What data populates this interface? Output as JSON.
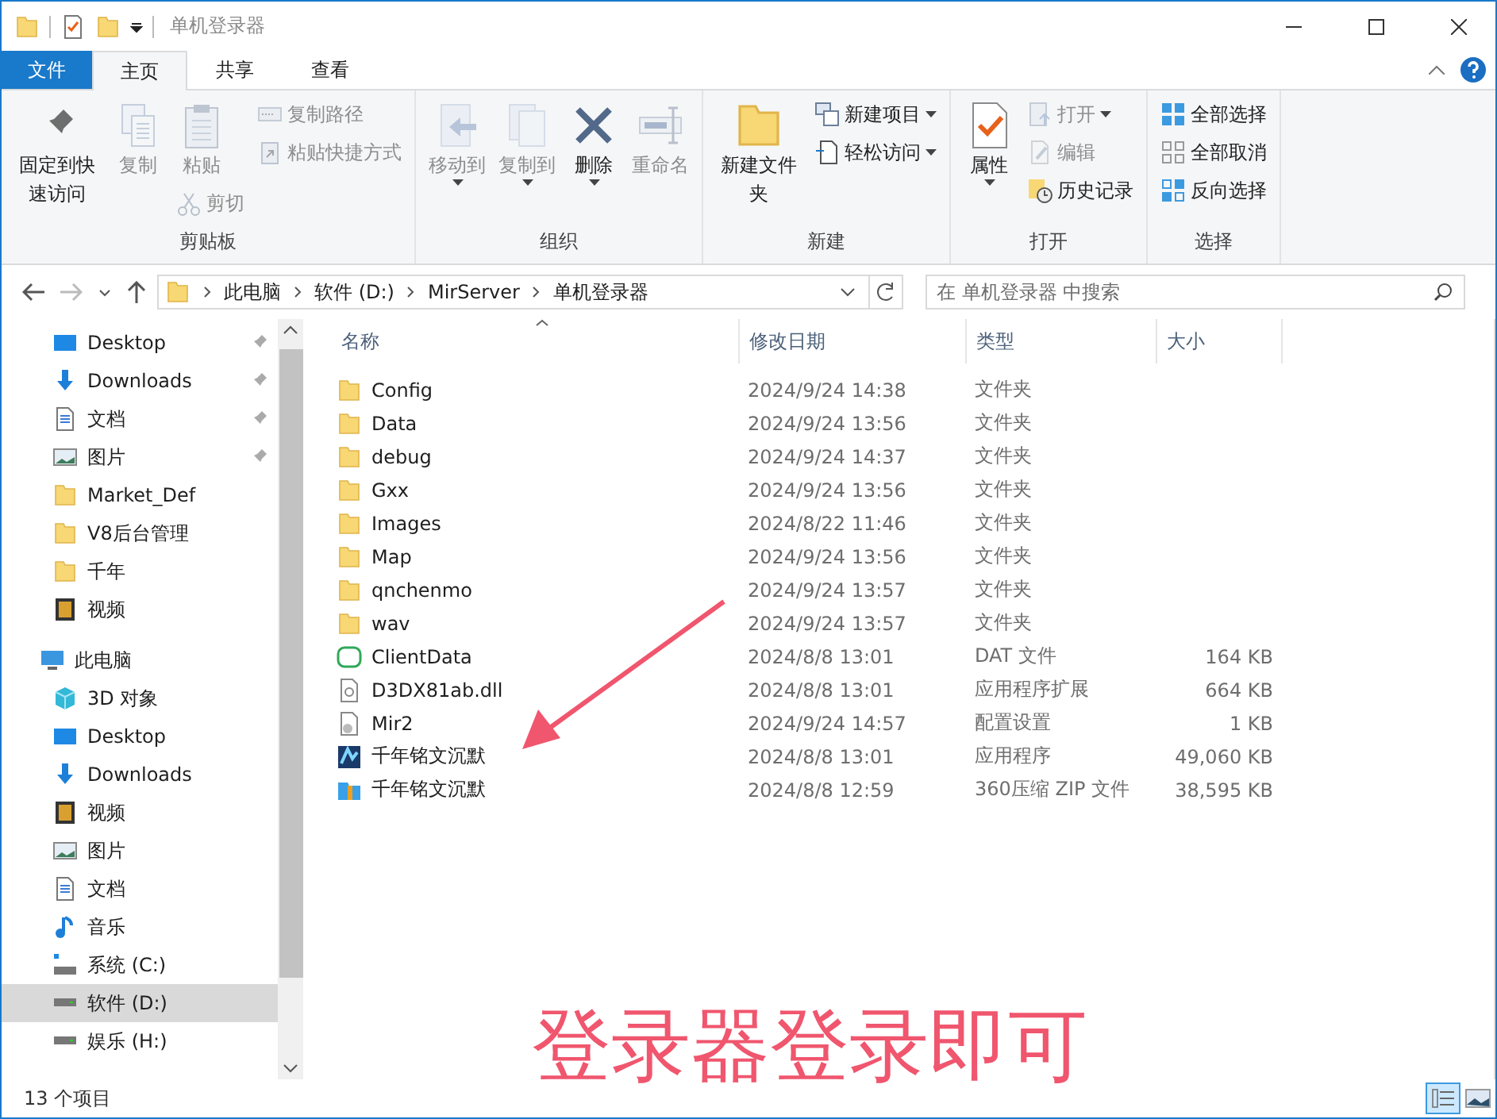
{
  "window": {
    "title": "单机登录器"
  },
  "ribbon": {
    "file_tab": "文件",
    "tabs": [
      {
        "label": "主页",
        "selected": true
      },
      {
        "label": "共享",
        "selected": false
      },
      {
        "label": "查看",
        "selected": false
      }
    ],
    "groups": [
      {
        "label": "剪贴板",
        "columns": [
          [
            {
              "label": "固定到快速访问",
              "kind": "large",
              "disabled": false,
              "dropdown": false
            }
          ],
          [
            {
              "label": "复制",
              "kind": "large",
              "disabled": true,
              "dropdown": false
            }
          ],
          [
            {
              "label": "粘贴",
              "kind": "large",
              "disabled": true,
              "dropdown": false
            },
            {
              "label": "剪切",
              "kind": "small",
              "disabled": true,
              "dropdown": false
            }
          ],
          [
            {
              "label": "复制路径",
              "kind": "small",
              "disabled": true,
              "dropdown": false
            },
            {
              "label": "粘贴快捷方式",
              "kind": "small",
              "disabled": true,
              "dropdown": false
            }
          ]
        ]
      },
      {
        "label": "组织",
        "columns": [
          [
            {
              "label": "移动到",
              "kind": "large",
              "disabled": true,
              "dropdown": true
            }
          ],
          [
            {
              "label": "复制到",
              "kind": "large",
              "disabled": true,
              "dropdown": true
            }
          ],
          [
            {
              "label": "删除",
              "kind": "large",
              "disabled": false,
              "dropdown": true
            }
          ],
          [
            {
              "label": "重命名",
              "kind": "large",
              "disabled": true,
              "dropdown": false
            }
          ]
        ]
      },
      {
        "label": "新建",
        "columns": [
          [
            {
              "label": "新建文件夹",
              "kind": "large",
              "disabled": false,
              "dropdown": false
            }
          ],
          [
            {
              "label": "新建项目",
              "kind": "small",
              "disabled": false,
              "dropdown": true
            },
            {
              "label": "轻松访问",
              "kind": "small",
              "disabled": false,
              "dropdown": true
            }
          ]
        ]
      },
      {
        "label": "打开",
        "columns": [
          [
            {
              "label": "属性",
              "kind": "large",
              "disabled": false,
              "dropdown": true
            }
          ],
          [
            {
              "label": "打开",
              "kind": "small",
              "disabled": true,
              "dropdown": true
            },
            {
              "label": "编辑",
              "kind": "small",
              "disabled": true,
              "dropdown": false
            },
            {
              "label": "历史记录",
              "kind": "small",
              "disabled": false,
              "dropdown": false
            }
          ]
        ]
      },
      {
        "label": "选择",
        "columns": [
          [
            {
              "label": "全部选择",
              "kind": "small",
              "disabled": false,
              "dropdown": false
            },
            {
              "label": "全部取消",
              "kind": "small",
              "disabled": false,
              "dropdown": false
            },
            {
              "label": "反向选择",
              "kind": "small",
              "disabled": false,
              "dropdown": false
            }
          ]
        ]
      }
    ]
  },
  "address": {
    "crumbs": [
      "此电脑",
      "软件 (D:)",
      "MirServer",
      "单机登录器"
    ]
  },
  "search": {
    "placeholder": "在 单机登录器 中搜索"
  },
  "nav": {
    "quick_access": [
      {
        "label": "Desktop",
        "kind": "desktop",
        "pinned": true,
        "selected": false
      },
      {
        "label": "Downloads",
        "kind": "downloads",
        "pinned": true,
        "selected": false
      },
      {
        "label": "文档",
        "kind": "documents",
        "pinned": true,
        "selected": false
      },
      {
        "label": "图片",
        "kind": "pictures",
        "pinned": true,
        "selected": false
      },
      {
        "label": "Market_Def",
        "kind": "folder",
        "pinned": false,
        "selected": false
      },
      {
        "label": "V8后台管理",
        "kind": "folder",
        "pinned": false,
        "selected": false
      },
      {
        "label": "千年",
        "kind": "folder",
        "pinned": false,
        "selected": false
      },
      {
        "label": "视频",
        "kind": "videos",
        "pinned": false,
        "selected": false
      }
    ],
    "tree": [
      {
        "label": "此电脑",
        "kind": "pc",
        "selected": false,
        "children": [
          {
            "label": "3D 对象",
            "kind": "objects3d",
            "selected": false
          },
          {
            "label": "Desktop",
            "kind": "desktop",
            "selected": false
          },
          {
            "label": "Downloads",
            "kind": "downloads",
            "selected": false
          },
          {
            "label": "视频",
            "kind": "videos",
            "selected": false
          },
          {
            "label": "图片",
            "kind": "pictures",
            "selected": false
          },
          {
            "label": "文档",
            "kind": "documents",
            "selected": false
          },
          {
            "label": "音乐",
            "kind": "music",
            "selected": false
          },
          {
            "label": "系统 (C:)",
            "kind": "system-drive",
            "selected": false
          },
          {
            "label": "软件 (D:)",
            "kind": "drive",
            "selected": true
          },
          {
            "label": "娱乐 (H:)",
            "kind": "drive",
            "selected": false
          }
        ]
      }
    ]
  },
  "files": {
    "columns": [
      {
        "label": "名称",
        "sorted": true
      },
      {
        "label": "修改日期",
        "sorted": false
      },
      {
        "label": "类型",
        "sorted": false
      },
      {
        "label": "大小",
        "sorted": false
      }
    ],
    "rows": [
      {
        "name": "Config",
        "modified": "2024/9/24 14:38",
        "type": "文件夹",
        "kind": "folder"
      },
      {
        "name": "Data",
        "modified": "2024/9/24 13:56",
        "type": "文件夹",
        "kind": "folder"
      },
      {
        "name": "debug",
        "modified": "2024/9/24 14:37",
        "type": "文件夹",
        "kind": "folder"
      },
      {
        "name": "Gxx",
        "modified": "2024/9/24 13:56",
        "type": "文件夹",
        "kind": "folder"
      },
      {
        "name": "Images",
        "modified": "2024/8/22 11:46",
        "type": "文件夹",
        "kind": "folder"
      },
      {
        "name": "Map",
        "modified": "2024/9/24 13:56",
        "type": "文件夹",
        "kind": "folder"
      },
      {
        "name": "qnchenmo",
        "modified": "2024/9/24 13:57",
        "type": "文件夹",
        "kind": "folder"
      },
      {
        "name": "wav",
        "modified": "2024/9/24 13:57",
        "type": "文件夹",
        "kind": "folder"
      },
      {
        "name": "ClientData",
        "modified": "2024/8/8 13:01",
        "type": "DAT 文件",
        "size": "164 KB",
        "kind": "data"
      },
      {
        "name": "D3DX81ab.dll",
        "modified": "2024/8/8 13:01",
        "type": "应用程序扩展",
        "size": "664 KB",
        "kind": "dll"
      },
      {
        "name": "Mir2",
        "modified": "2024/9/24 14:57",
        "type": "配置设置",
        "size": "1 KB",
        "kind": "config"
      },
      {
        "name": "千年铭文沉默",
        "modified": "2024/8/8 13:01",
        "type": "应用程序",
        "size": "49,060 KB",
        "kind": "exe"
      },
      {
        "name": "千年铭文沉默",
        "modified": "2024/8/8 12:59",
        "type": "360压缩 ZIP 文件",
        "size": "38,595 KB",
        "kind": "zip"
      }
    ]
  },
  "status_bar": {
    "count": "13 个项目",
    "views": [
      {
        "selected": true
      },
      {
        "selected": false
      }
    ]
  },
  "annotation": {
    "text": "登录器登录即可"
  }
}
